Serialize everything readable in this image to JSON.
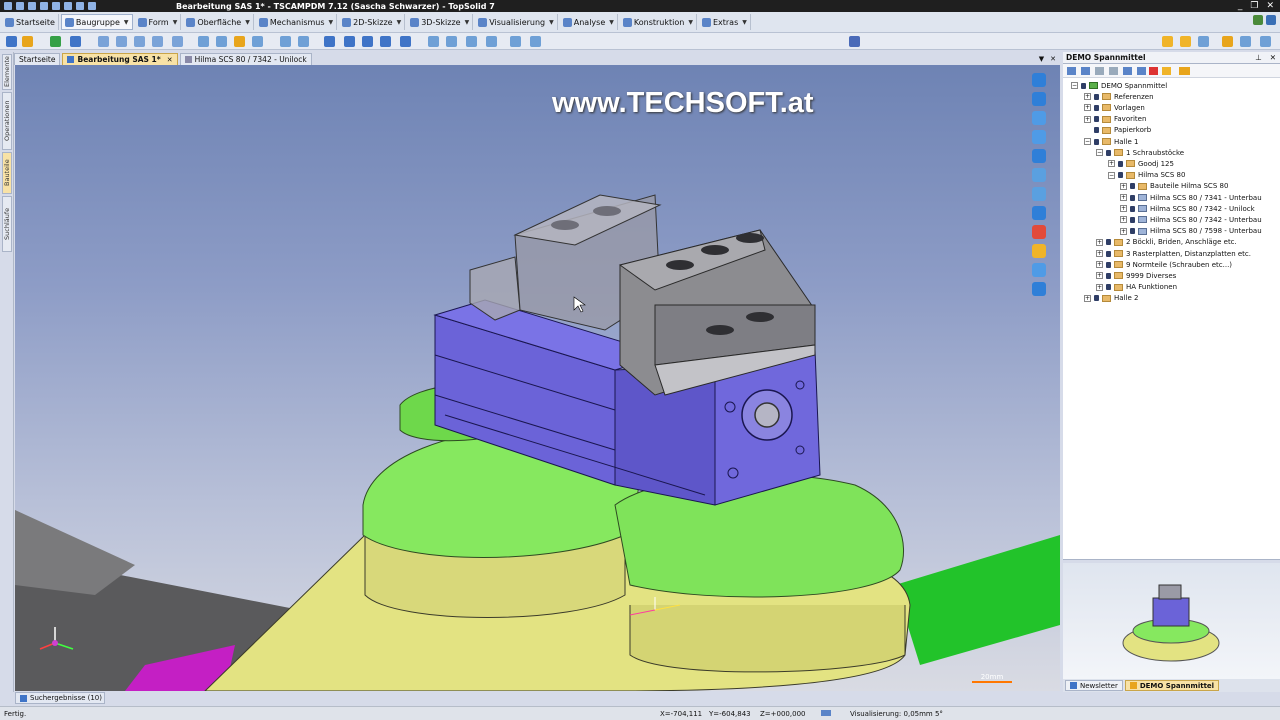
{
  "window": {
    "title": "Bearbeitung SAS 1* - TSCAMPDM 7.12 (Sascha Schwarzer) - TopSolid 7",
    "controls": [
      "_",
      "❐",
      "✕"
    ]
  },
  "menubar": [
    {
      "label": "Startseite",
      "active": false
    },
    {
      "label": "Baugruppe",
      "active": true
    },
    {
      "label": "Form",
      "active": false
    },
    {
      "label": "Oberfläche",
      "active": false
    },
    {
      "label": "Mechanismus",
      "active": false
    },
    {
      "label": "2D-Skizze",
      "active": false
    },
    {
      "label": "3D-Skizze",
      "active": false
    },
    {
      "label": "Visualisierung",
      "active": false
    },
    {
      "label": "Analyse",
      "active": false
    },
    {
      "label": "Konstruktion",
      "active": false
    },
    {
      "label": "Extras",
      "active": false
    }
  ],
  "doc_tabs": [
    {
      "label": "Startseite",
      "active": false
    },
    {
      "label": "Bearbeitung SAS 1*",
      "active": true
    },
    {
      "label": "Hilma SCS 80 / 7342 - Unilock",
      "active": false
    }
  ],
  "left_tabs": [
    "Elemente",
    "Operationen",
    "Bauteile",
    "Suchläufe"
  ],
  "viewport": {
    "watermark": "www.TECHSOFT.at",
    "scale_label": "20mm"
  },
  "right_panel": {
    "title": "DEMO Spannmittel",
    "tree": [
      {
        "label": "DEMO Spannmittel",
        "level": 0,
        "toggle": "−",
        "icon": "root"
      },
      {
        "label": "Referenzen",
        "level": 1,
        "toggle": "+",
        "icon": "folder"
      },
      {
        "label": "Vorlagen",
        "level": 1,
        "toggle": "+",
        "icon": "folder"
      },
      {
        "label": "Favoriten",
        "level": 1,
        "toggle": "+",
        "icon": "folder"
      },
      {
        "label": "Papierkorb",
        "level": 1,
        "toggle": "",
        "icon": "bin"
      },
      {
        "label": "Halle 1",
        "level": 1,
        "toggle": "−",
        "icon": "folder"
      },
      {
        "label": "1 Schraubstöcke",
        "level": 2,
        "toggle": "−",
        "icon": "folder"
      },
      {
        "label": "Goodj 125",
        "level": 3,
        "toggle": "+",
        "icon": "folder"
      },
      {
        "label": "Hilma SCS 80",
        "level": 3,
        "toggle": "−",
        "icon": "folder"
      },
      {
        "label": "Bauteile Hilma SCS 80",
        "level": 4,
        "toggle": "+",
        "icon": "folder"
      },
      {
        "label": "Hilma SCS 80 / 7341 - Unterbau",
        "level": 4,
        "toggle": "+",
        "icon": "part"
      },
      {
        "label": "Hilma SCS 80 / 7342 - Unilock",
        "level": 4,
        "toggle": "+",
        "icon": "part"
      },
      {
        "label": "Hilma SCS 80 / 7342 - Unterbau",
        "level": 4,
        "toggle": "+",
        "icon": "part"
      },
      {
        "label": "Hilma SCS 80 / 7598 - Unterbau",
        "level": 4,
        "toggle": "+",
        "icon": "part"
      },
      {
        "label": "2 Böckli, Briden, Anschläge etc.",
        "level": 2,
        "toggle": "+",
        "icon": "folder"
      },
      {
        "label": "3 Rasterplatten, Distanzplatten etc.",
        "level": 2,
        "toggle": "+",
        "icon": "folder"
      },
      {
        "label": "9 Normteile (Schrauben etc...)",
        "level": 2,
        "toggle": "+",
        "icon": "folder"
      },
      {
        "label": "9999 Diverses",
        "level": 2,
        "toggle": "+",
        "icon": "folder"
      },
      {
        "label": "HA Funktionen",
        "level": 2,
        "toggle": "+",
        "icon": "folder"
      },
      {
        "label": "Halle 2",
        "level": 1,
        "toggle": "+",
        "icon": "folder"
      }
    ],
    "tabs": [
      {
        "label": "Newsletter",
        "active": false
      },
      {
        "label": "DEMO Spannmittel",
        "active": true
      }
    ]
  },
  "search_results_tab": "Suchergebnisse (10)",
  "status": {
    "left": "Fertig.",
    "x": "X=-704,111",
    "y": "Y=-604,843",
    "z": "Z=+000,000",
    "visualization": "Visualisierung: 0,05mm 5°"
  },
  "colors": {
    "vise_body": "#6a63d8",
    "jaw": "#8d8d8f",
    "base_yellow": "#e0e07a",
    "base_green": "#7ee05e",
    "accent_active_tab": "#f8e2a6"
  }
}
